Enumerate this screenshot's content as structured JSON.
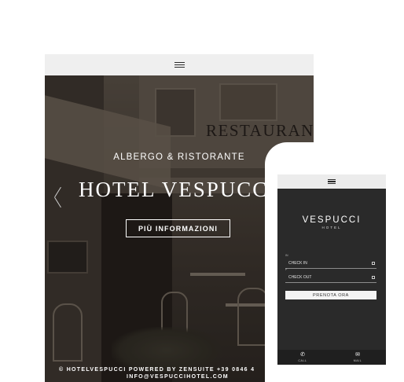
{
  "tablet": {
    "hero": {
      "background_sign": "RESTAURANT",
      "subtitle": "ALBERGO & RISTORANTE",
      "title": "HOTEL VESPUCCI",
      "button_label": "PIÙ INFORMAZIONI"
    },
    "footer": {
      "line1": "© HOTELVESPUCCI POWERED BY ZENSUITE   +39 0846 4",
      "line2": "INFO@VESPUCCIHOTEL.COM"
    }
  },
  "phone": {
    "brand": {
      "name": "VESPUCCI",
      "sub": "HOTEL"
    },
    "checkin": {
      "label": "IN",
      "value": "CHECK IN"
    },
    "checkout": {
      "label": "P",
      "value": "CHECK OUT"
    },
    "book_label": "PRENOTA ORA",
    "footer": {
      "call": {
        "icon": "phone-icon",
        "label": "CALL"
      },
      "mail": {
        "icon": "envelope-icon",
        "label": "MAIL"
      }
    }
  }
}
